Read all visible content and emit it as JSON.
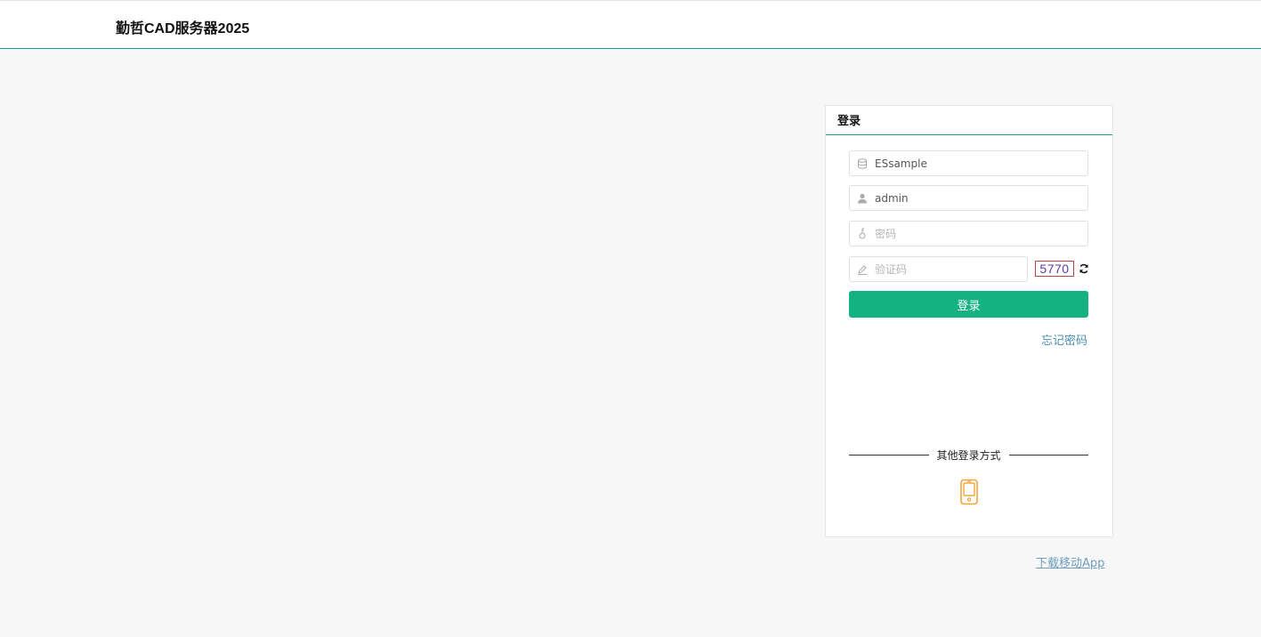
{
  "header": {
    "title": "勤哲CAD服务器2025"
  },
  "login_panel": {
    "title": "登录",
    "database_field": {
      "value": "ESsample",
      "placeholder": ""
    },
    "username_field": {
      "value": "admin",
      "placeholder": ""
    },
    "password_field": {
      "value": "",
      "placeholder": "密码"
    },
    "captcha_field": {
      "value": "",
      "placeholder": "验证码"
    },
    "captcha_code": "5770",
    "login_button": "登录",
    "forgot_password": "忘记密码",
    "other_login_label": "其他登录方式"
  },
  "download_app_link": "下载移动App",
  "icons": {
    "database": "database-icon",
    "user": "user-icon",
    "key": "key-icon",
    "pen": "pen-icon",
    "refresh": "refresh-icon",
    "mobile": "mobile-phone-icon"
  },
  "colors": {
    "accent": "#16a085",
    "button": "#13b280",
    "link": "#4a8fb3",
    "phone_icon": "#f0a63a"
  }
}
